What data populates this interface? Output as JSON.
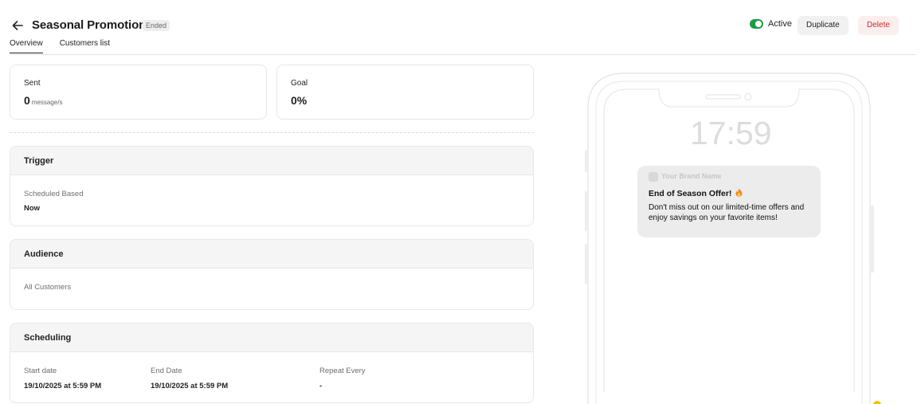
{
  "header": {
    "title": "Seasonal Promotions",
    "status": "Ended",
    "active_label": "Active",
    "duplicate_label": "Duplicate",
    "delete_label": "Delete",
    "active": true
  },
  "tabs": [
    {
      "label": "Overview",
      "active": true
    },
    {
      "label": "Customers list",
      "active": false
    }
  ],
  "stats": {
    "sent": {
      "label": "Sent",
      "value": "0",
      "unit": "message/s"
    },
    "goal": {
      "label": "Goal",
      "value": "0%"
    }
  },
  "trigger": {
    "title": "Trigger",
    "field_label": "Scheduled Based",
    "field_value": "Now"
  },
  "audience": {
    "title": "Audience",
    "value": "All Customers"
  },
  "scheduling": {
    "title": "Scheduling",
    "start_label": "Start date",
    "start_value": "19/10/2025 at 5:59 PM",
    "end_label": "End Date",
    "end_value": "19/10/2025 at 5:59 PM",
    "repeat_label": "Repeat Every",
    "repeat_value": "-"
  },
  "preview": {
    "clock": "17:59",
    "brand_name": "Your Brand Name",
    "notif_title": "End of Season Offer!",
    "notif_body": "Don't miss out on our limited-time offers and enjoy savings on your favorite items!"
  },
  "colors": {
    "toggle_on": "#1e9b43",
    "delete_text": "#d0272d",
    "delete_bg": "#fbeeee"
  }
}
